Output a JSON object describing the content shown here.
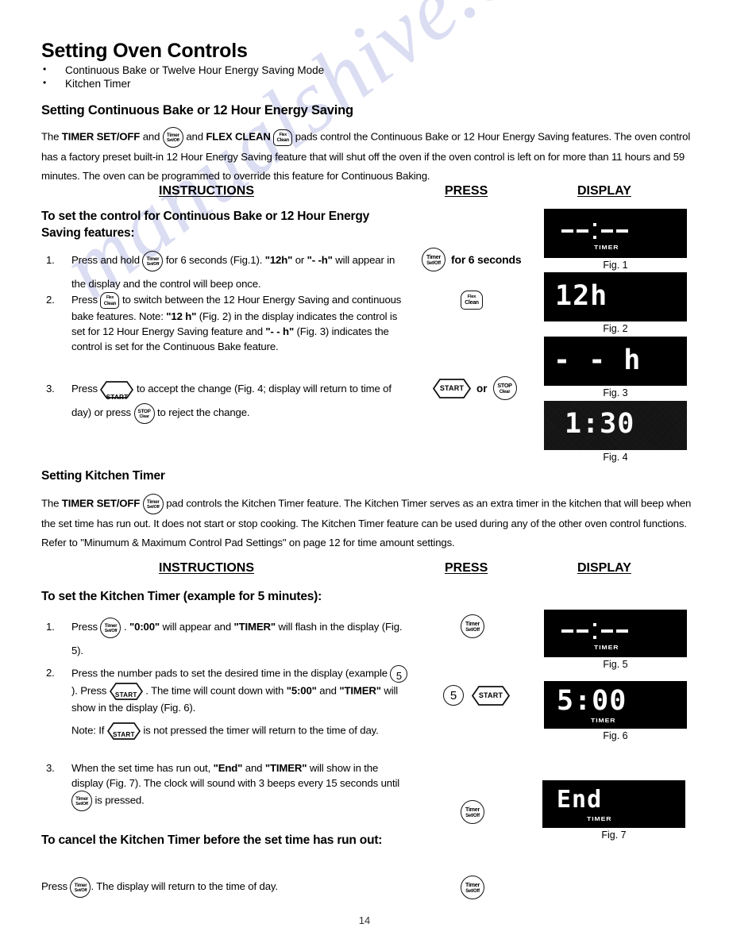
{
  "page": {
    "number": "14",
    "watermark": "manualshive.com"
  },
  "header": {
    "title": "Setting Oven Controls",
    "bullets": [
      "Continuous Bake or Twelve Hour Energy Saving Mode",
      "Kitchen Timer"
    ]
  },
  "section1": {
    "heading": "Setting Continuous Bake or 12 Hour Energy Saving",
    "intro_line1_a": "The ",
    "intro_line1_b": "TIMER SET/OFF",
    "intro_line1_c": " and ",
    "intro_line1_d": "FLEX CLEAN",
    "intro_line1_e": " pads control the Continuous Bake or 12 Hour Energy Saving features.",
    "intro_line2": "The oven control has a factory preset built-in 12 Hour Energy Saving feature that will shut off the oven if the oven control is left on for more than 11 hours and 59 minutes. The oven can be programmed to override this feature for Continuous Baking.",
    "col_instructions": "INSTRUCTIONS",
    "col_press": "PRESS",
    "col_display": "DISPLAY",
    "subhead": "To set the control for Continuous Bake or 12 Hour Energy Saving features:",
    "steps": [
      {
        "num": "1.",
        "a": "Press and hold ",
        "b": " for 6 seconds (Fig.1). ",
        "c": "\"12h\"",
        "d": " or ",
        "e": "\"- -h\"",
        "f": "  will appear in the display and the control will beep once."
      },
      {
        "num": "2.",
        "a": "Press ",
        "b": " to switch between the 12 Hour Energy Saving and continuous bake features. Note: ",
        "c": "\"12 h\"",
        "d": " (Fig. 2) in the display indicates the control is set for 12 Hour Energy Saving feature and ",
        "e": "\"- - h\"",
        "f": " (Fig. 3) indicates the control is set for the Continuous Bake feature."
      },
      {
        "num": "3.",
        "a": "Press ",
        "b": " to accept the change (Fig. 4; display will return to time of day) or press ",
        "c": " to reject the change."
      }
    ],
    "press": {
      "step1_suffix": "for 6 seconds",
      "step3_or": "or"
    }
  },
  "section2": {
    "heading": "Setting Kitchen Timer",
    "intro_a": "The ",
    "intro_b": "TIMER SET/OFF",
    "intro_c": " pad controls the Kitchen Timer feature. The Kitchen Timer serves as an extra timer in the kitchen that will beep when the set time has run out.  It does not start or stop cooking.  The Kitchen Timer feature can be used during any of the other oven control functions. Refer to \"Minumum  & Maximum Control Pad Settings\" on page 12 for time amount settings.",
    "col_instructions": "INSTRUCTIONS",
    "col_press": "PRESS",
    "col_display": "DISPLAY",
    "subhead": "To set the Kitchen Timer (example for 5 minutes):",
    "steps": [
      {
        "num": "1.",
        "a": "Press ",
        "b": " . ",
        "c": "\"0:00\"",
        "d": " will appear and ",
        "e": "\"TIMER\"",
        "f": " will flash in the display (Fig. 5)."
      },
      {
        "num": "2.",
        "a": "Press the number pads to set the desired time in the display (example ",
        "b": "). ",
        "c": " Press ",
        "d": " . The time will count down with ",
        "e": "\"5:00\"",
        "f": " and ",
        "g": "\"TIMER\"",
        "h": " will show in the display (Fig. 6).",
        "note_a": "Note: If ",
        "note_b": " is not pressed the timer will return to the time of day."
      },
      {
        "num": "3.",
        "a": "When the set time has run out, ",
        "b": "\"End\"",
        "c": " and ",
        "d": "\"TIMER\"",
        "e": " will show in the display (Fig. 7). The clock will sound with 3 beeps every 15 seconds until ",
        "f": " is pressed."
      }
    ],
    "cancel_heading": "To cancel the Kitchen Timer before the set time has run out:",
    "cancel_a": "Press ",
    "cancel_b": ".  The display will return to the time of day."
  },
  "pads": {
    "timer": {
      "line1": "Timer",
      "line2": "Set/Off",
      "name": "timer-set-off-pad"
    },
    "flex": {
      "line1": "Flex",
      "line2": "Clean",
      "name": "flex-clean-pad"
    },
    "start": {
      "label": "START",
      "name": "start-pad"
    },
    "stop": {
      "line1": "STOP",
      "line2": "Clear",
      "name": "stop-clear-pad"
    },
    "five": {
      "label": "5",
      "name": "number-5-pad"
    }
  },
  "figures": [
    {
      "id": "fig1",
      "caption": "Fig. 1",
      "readout": "--:--",
      "style": "dashclock",
      "timer_label": "TIMER",
      "noise": false
    },
    {
      "id": "fig2",
      "caption": "Fig. 2",
      "readout": "12h",
      "style": "text",
      "timer_label": "",
      "noise": false
    },
    {
      "id": "fig3",
      "caption": "Fig. 3",
      "readout": "- - h",
      "style": "text",
      "timer_label": "",
      "noise": false
    },
    {
      "id": "fig4",
      "caption": "Fig. 4",
      "readout": "1:30",
      "style": "text",
      "timer_label": "",
      "noise": true
    },
    {
      "id": "fig5",
      "caption": "Fig. 5",
      "readout": "--:--",
      "style": "dashclock",
      "timer_label": "TIMER",
      "noise": false
    },
    {
      "id": "fig6",
      "caption": "Fig. 6",
      "readout": "5:00",
      "style": "text",
      "timer_label": "TIMER",
      "noise": false
    },
    {
      "id": "fig7",
      "caption": "Fig. 7",
      "readout": "End",
      "style": "text",
      "timer_label": "TIMER",
      "noise": false
    }
  ]
}
